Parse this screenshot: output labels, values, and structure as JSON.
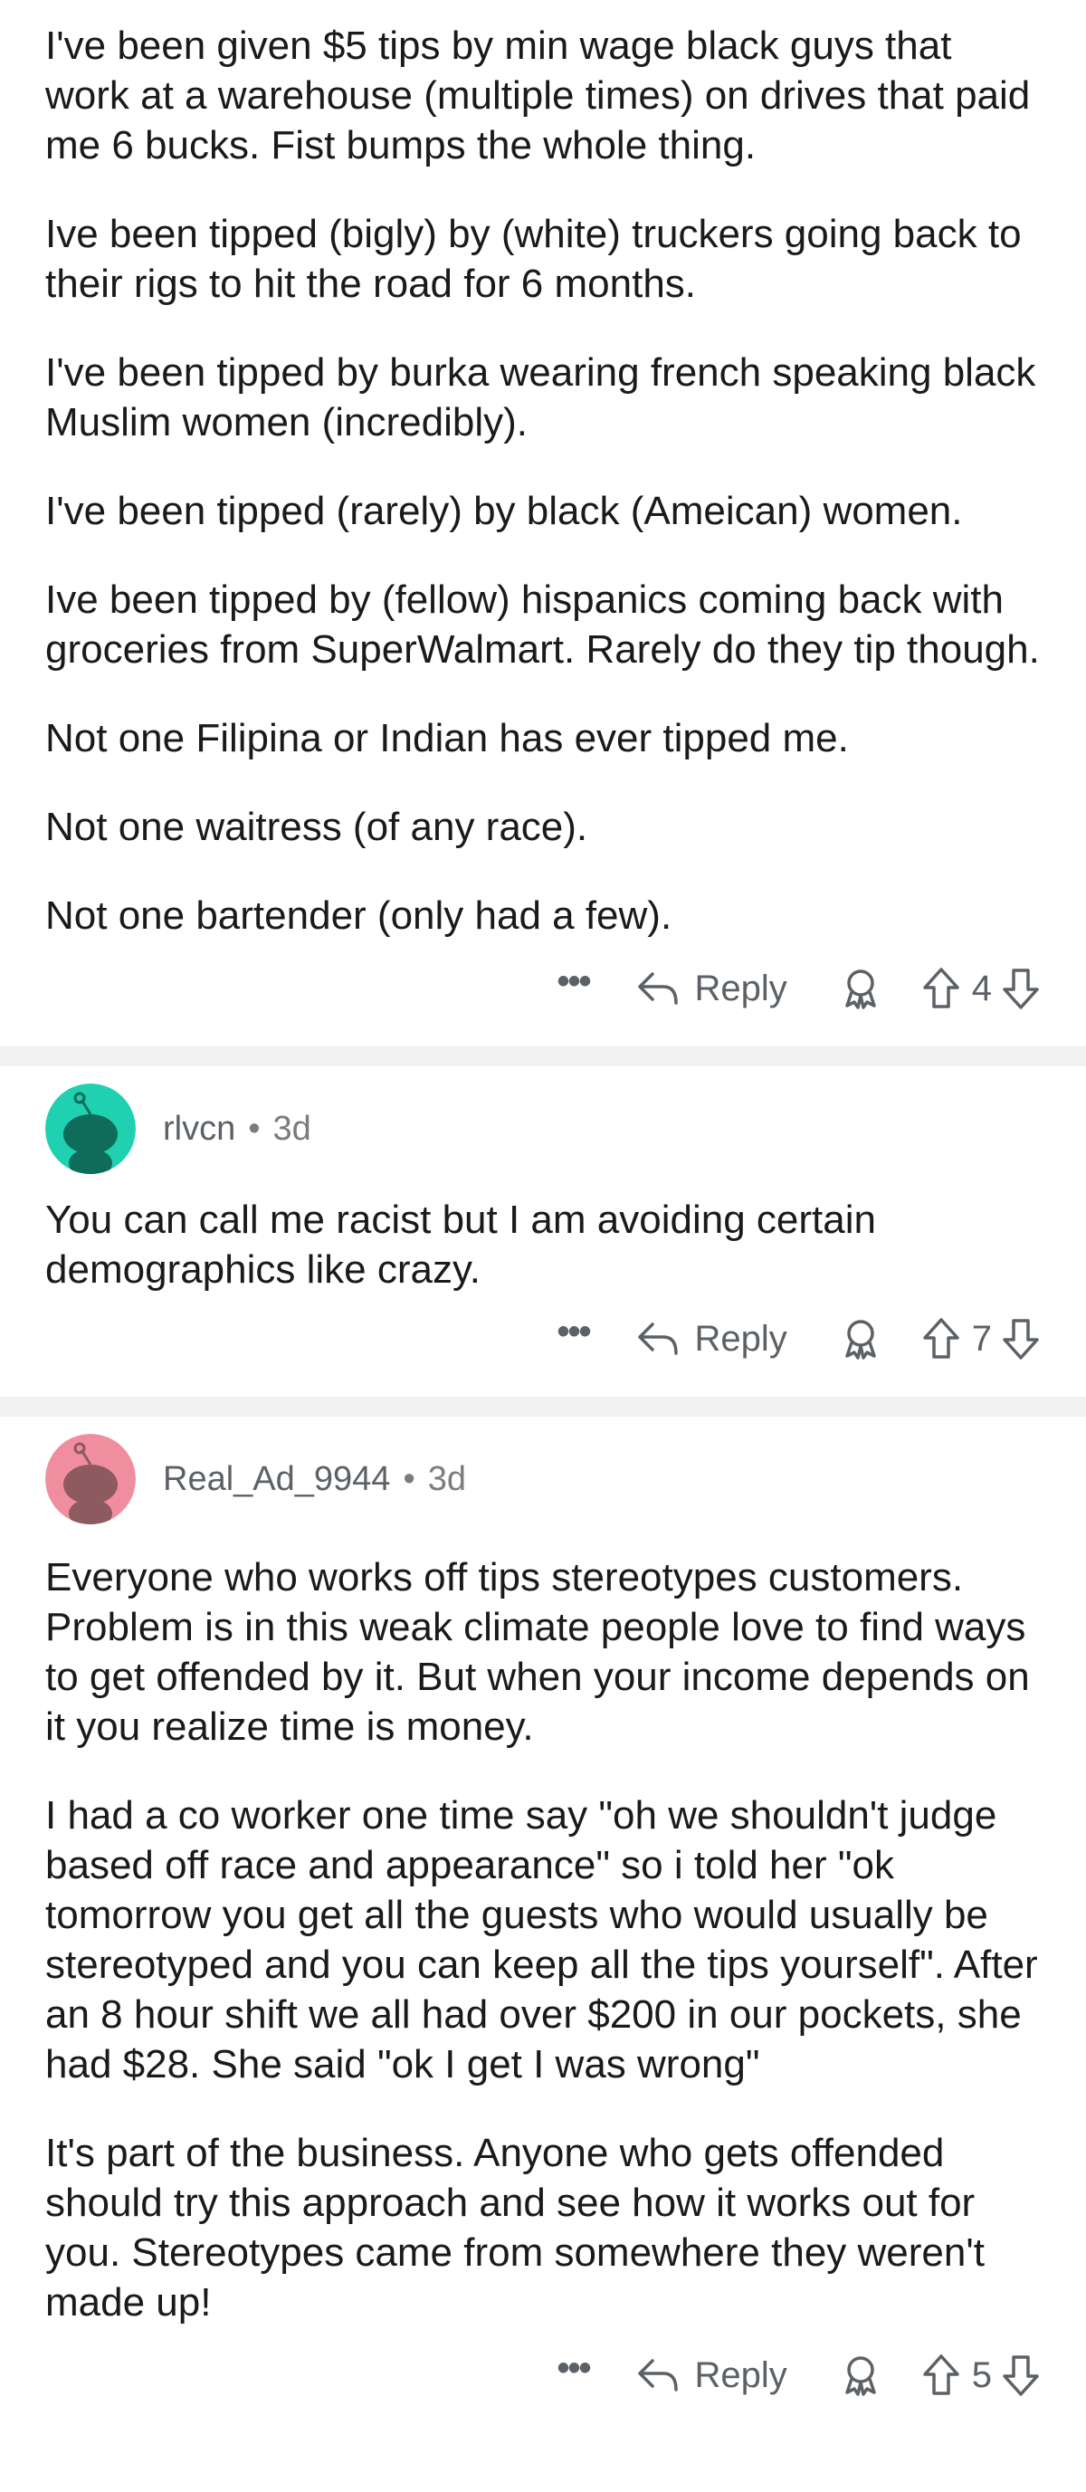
{
  "comments": [
    {
      "username": "",
      "age": "",
      "paragraphs": [
        "I've been given $5 tips by min wage black guys that work at a warehouse (multiple times) on drives that paid me 6 bucks. Fist bumps the whole thing.",
        "Ive been tipped (bigly) by (white) truckers going back to their rigs to hit the road for 6 months.",
        "I've been tipped by burka wearing french speaking black Muslim women (incredibly).",
        "I've been tipped (rarely) by black (Ameican) women.",
        "Ive been tipped by (fellow) hispanics coming back with groceries from SuperWalmart.  Rarely do they tip though.",
        "Not one Filipina or Indian has ever tipped me.",
        "Not one waitress (of any race).",
        "Not one bartender (only had a few)."
      ],
      "actions": {
        "more": "•••",
        "reply_label": "Reply",
        "vote_count": "4"
      }
    },
    {
      "username": "rlvcn",
      "separator": "•",
      "age": "3d",
      "avatar_color": "#1fd1b0",
      "paragraphs": [
        "You can call me racist but I am avoiding certain demographics like crazy."
      ],
      "actions": {
        "more": "•••",
        "reply_label": "Reply",
        "vote_count": "7"
      }
    },
    {
      "username": "Real_Ad_9944",
      "separator": "•",
      "age": "3d",
      "avatar_color": "#f08ea0",
      "paragraphs": [
        "Everyone who works off tips stereotypes customers. Problem is in this weak climate people love to find ways to get offended by it. But when your income depends on it you realize time is money.",
        "I had a co worker one time say \"oh we shouldn't judge based off race and appearance\" so i told her \"ok tomorrow you get all the guests who would usually be stereotyped and you can keep all the tips yourself\". After an 8 hour shift we all had over $200 in our pockets, she had $28. She said \"ok I get I was wrong\"",
        "It's part of the business. Anyone who gets offended should try this approach and see how it works out for you. Stereotypes came from somewhere they weren't made up!"
      ],
      "actions": {
        "more": "•••",
        "reply_label": "Reply",
        "vote_count": "5"
      }
    }
  ],
  "colors": {
    "text": "#1a1a1b",
    "meta": "#7c7c7c",
    "divider": "#eff1f3"
  },
  "icons": [
    "more-icon",
    "reply-arrow-icon",
    "award-icon",
    "upvote-icon",
    "downvote-icon",
    "snoo-avatar-icon"
  ]
}
